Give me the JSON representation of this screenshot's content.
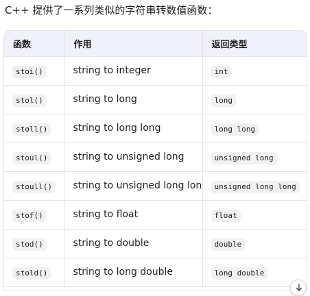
{
  "intro_text": "C++ 提供了一系列类似的字符串转数值函数：",
  "table": {
    "headers": [
      "函数",
      "作用",
      "返回类型"
    ],
    "rows": [
      {
        "func": "stoi()",
        "desc": "string to integer",
        "ret": "int"
      },
      {
        "func": "stol()",
        "desc": "string to long",
        "ret": "long"
      },
      {
        "func": "stoll()",
        "desc": "string to long long",
        "ret": "long long"
      },
      {
        "func": "stoul()",
        "desc": "string to unsigned long",
        "ret": "unsigned long"
      },
      {
        "func": "stoull()",
        "desc": "string to unsigned long long",
        "ret": "unsigned long long"
      },
      {
        "func": "stof()",
        "desc": "string to float",
        "ret": "float"
      },
      {
        "func": "stod()",
        "desc": "string to double",
        "ret": "double"
      },
      {
        "func": "stold()",
        "desc": "string to long double",
        "ret": "long double"
      }
    ]
  },
  "scroll_button": {
    "icon": "arrow-down-icon"
  }
}
